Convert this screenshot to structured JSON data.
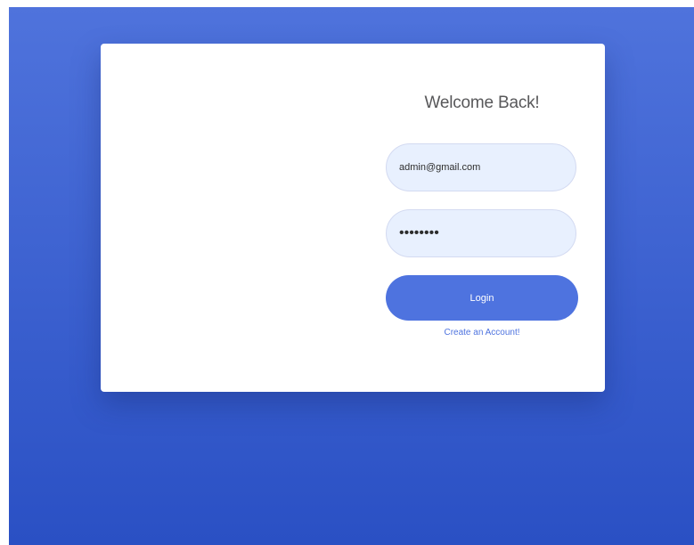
{
  "login": {
    "title": "Welcome Back!",
    "email_value": "admin@gmail.com",
    "password_value": "password",
    "login_label": "Login",
    "create_account_label": "Create an Account!"
  },
  "colors": {
    "background_top": "#4f73dc",
    "background_bottom": "#2a50c4",
    "accent": "#4e73df",
    "input_fill": "#e8f0fe"
  }
}
